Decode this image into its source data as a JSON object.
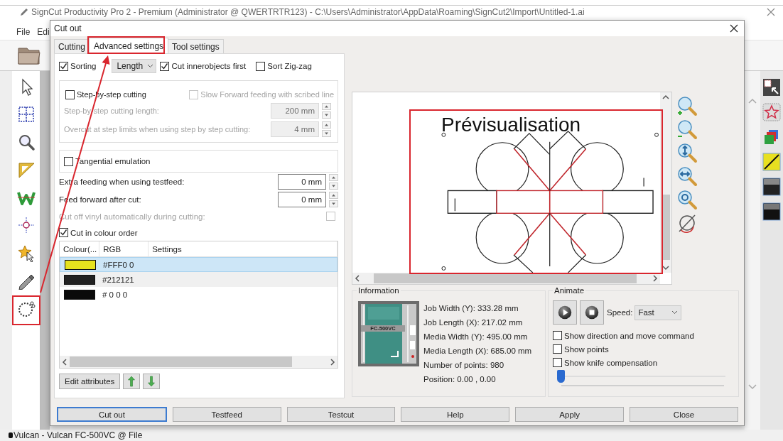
{
  "app": {
    "title": "SignCut Productivity Pro 2 - Premium (Administrator @ QWERTRTR123) - C:\\Users\\Administrator\\AppData\\Roaming\\SignCut2\\Import\\Untitled-1.ai",
    "menu": [
      "File",
      "Edi"
    ],
    "status_bar": "Vulcan - Vulcan FC-500VC @ File"
  },
  "dialog": {
    "title": "Cut out",
    "tabs": [
      {
        "label": "Cutting",
        "selected": false
      },
      {
        "label": "Advanced settings",
        "selected": true
      },
      {
        "label": "Tool settings",
        "selected": false
      }
    ],
    "sorting": {
      "label": "Sorting",
      "checked": true,
      "order": "Length"
    },
    "inner_first": {
      "label": "Cut innerobjects first",
      "checked": true
    },
    "zigzag": {
      "label": "Sort Zig-zag",
      "checked": false
    },
    "step_cutting": {
      "label": "Step-by-step cutting",
      "checked": false
    },
    "slow_forward": {
      "label": "Slow Forward feeding with scribed line",
      "checked": false,
      "disabled": true
    },
    "step_fields": [
      {
        "label": "Step-by-step cutting length:",
        "value": "200 mm",
        "disabled": true
      },
      {
        "label": "Overcut at step limits when using step by step cutting:",
        "value": "4 mm",
        "disabled": true
      }
    ],
    "tangential": {
      "label": "Tangential emulation",
      "checked": false
    },
    "feed_fields": [
      {
        "label": "Extra feeding when using testfeed:",
        "value": "0 mm",
        "disabled": false
      },
      {
        "label": "Feed forward after cut:",
        "value": "0 mm",
        "disabled": false
      }
    ],
    "cut_off_vinyl": {
      "label": "Cut off vinyl automatically during cutting:",
      "checked": false,
      "disabled": true
    },
    "colour_order": {
      "label": "Cut in colour order",
      "checked": true
    },
    "colour_table": {
      "columns": [
        "Colour(...",
        "RGB",
        "Settings"
      ],
      "rows": [
        {
          "color": "#e6e21e",
          "rgb": "#FFF0 0",
          "selected": true
        },
        {
          "color": "#212121",
          "rgb": "#212121",
          "selected": false
        },
        {
          "color": "#0a0a0a",
          "rgb": "# 0 0 0",
          "selected": false
        }
      ]
    },
    "edit_button": "Edit attributes",
    "preview": {
      "caption": "Prévisualisation"
    },
    "information": {
      "title": "Information",
      "device_label": "FC-500VC",
      "lines": [
        "Job Width (Y): 333.28 mm",
        "Job Length (X): 217.02 mm",
        "Media Width (Y): 495.00 mm",
        "Media Length (X): 685.00 mm",
        "Number of points: 980",
        "Position: 0.00 , 0.00"
      ]
    },
    "animate": {
      "title": "Animate",
      "speed_label": "Speed:",
      "speed": "Fast",
      "options": [
        {
          "label": "Show direction and move command",
          "checked": false
        },
        {
          "label": "Show points",
          "checked": false
        },
        {
          "label": "Show knife compensation",
          "checked": false
        }
      ],
      "level": 0
    },
    "buttons": [
      {
        "label": "Cut out",
        "default": true
      },
      {
        "label": "Testfeed",
        "default": false
      },
      {
        "label": "Testcut",
        "default": false
      },
      {
        "label": "Help",
        "default": false
      },
      {
        "label": "Apply",
        "default": false
      },
      {
        "label": "Close",
        "default": false
      }
    ]
  }
}
